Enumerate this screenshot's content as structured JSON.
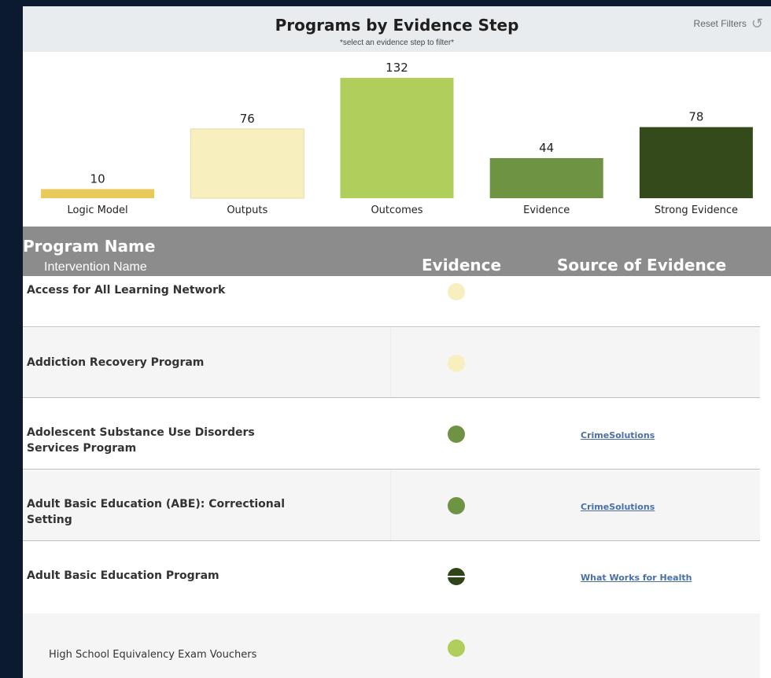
{
  "header": {
    "title": "Programs by Evidence Step",
    "subtitle": "*select an evidence step to filter*",
    "reset_label": "Reset Filters",
    "reset_icon": "undo-icon"
  },
  "chart_data": {
    "type": "bar",
    "title": "Programs by Evidence Step",
    "categories": [
      "Logic Model",
      "Outputs",
      "Outcomes",
      "Evidence",
      "Strong Evidence"
    ],
    "values": [
      10,
      76,
      132,
      44,
      78
    ],
    "colors": [
      "#e8c95a",
      "#f8efbf",
      "#afce5b",
      "#6d9343",
      "#344a1b"
    ],
    "xlabel": "",
    "ylabel": "",
    "ylim": [
      0,
      132
    ],
    "grid": false,
    "legend": "none"
  },
  "table": {
    "headers": {
      "program": "Program Name",
      "intervention": "Intervention Name",
      "evidence": "Evidence",
      "source": "Source of Evidence"
    },
    "rows": [
      {
        "name": "Access for All Learning Network",
        "evidence_color": "#f8efbf",
        "source": "",
        "level": "program"
      },
      {
        "name": "Addiction Recovery Program",
        "evidence_color": "#f8efbf",
        "source": "",
        "level": "program"
      },
      {
        "name": "Adolescent Substance Use Disorders Services Program",
        "evidence_color": "#6d9343",
        "source": "CrimeSolutions",
        "level": "program"
      },
      {
        "name": "Adult Basic Education (ABE): Correctional Setting",
        "evidence_color": "#6d9343",
        "source": "CrimeSolutions",
        "level": "program"
      },
      {
        "name": "Adult Basic Education Program",
        "evidence_color": "#2f4417",
        "source": "What Works for Health",
        "level": "program"
      },
      {
        "name": "High School Equivalency Exam Vouchers",
        "evidence_color": "#afce5b",
        "source": "",
        "level": "intervention"
      }
    ]
  }
}
